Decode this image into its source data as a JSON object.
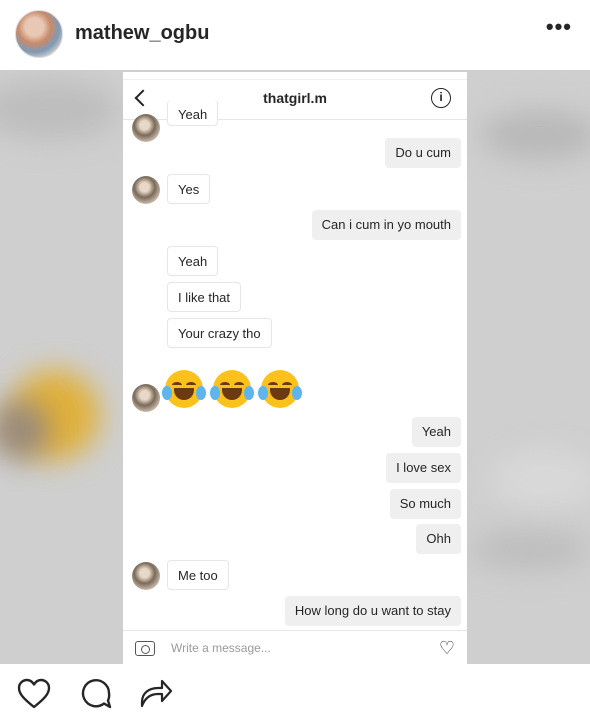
{
  "post": {
    "username": "mathew_ogbu",
    "more_label": "•••",
    "avatar_icon": "profile-photo"
  },
  "chat": {
    "title": "thatgirl.m",
    "info_label": "i",
    "back_icon": "chevron-left-icon",
    "messages": [
      {
        "side": "in",
        "text": "Yeah",
        "avatar": true
      },
      {
        "side": "out",
        "text": "Do u cum"
      },
      {
        "side": "in",
        "text": "Yes",
        "avatar": true
      },
      {
        "side": "out",
        "text": "Can i cum in yo mouth"
      },
      {
        "side": "in",
        "text": "Yeah"
      },
      {
        "side": "in",
        "text": "I like that"
      },
      {
        "side": "in",
        "text": "Your crazy tho"
      },
      {
        "side": "in",
        "emoji": "face-with-tears-of-joy x3",
        "avatar": true
      },
      {
        "side": "out",
        "text": "Yeah"
      },
      {
        "side": "out",
        "text": "I love sex"
      },
      {
        "side": "out",
        "text": "So much"
      },
      {
        "side": "out",
        "text": "Ohh"
      },
      {
        "side": "in",
        "text": "Me too",
        "avatar": true
      },
      {
        "side": "out",
        "text": "How long do u want to stay"
      }
    ],
    "composer_placeholder": "Write a message..."
  },
  "actions": {
    "icons": [
      "heart-icon",
      "comment-icon",
      "share-icon"
    ]
  },
  "colors": {
    "bubble_out": "#efefef",
    "bubble_in_border": "#e6e6e6",
    "emoji": "#fcc21b",
    "blur_bg": "#cfcfcf"
  }
}
